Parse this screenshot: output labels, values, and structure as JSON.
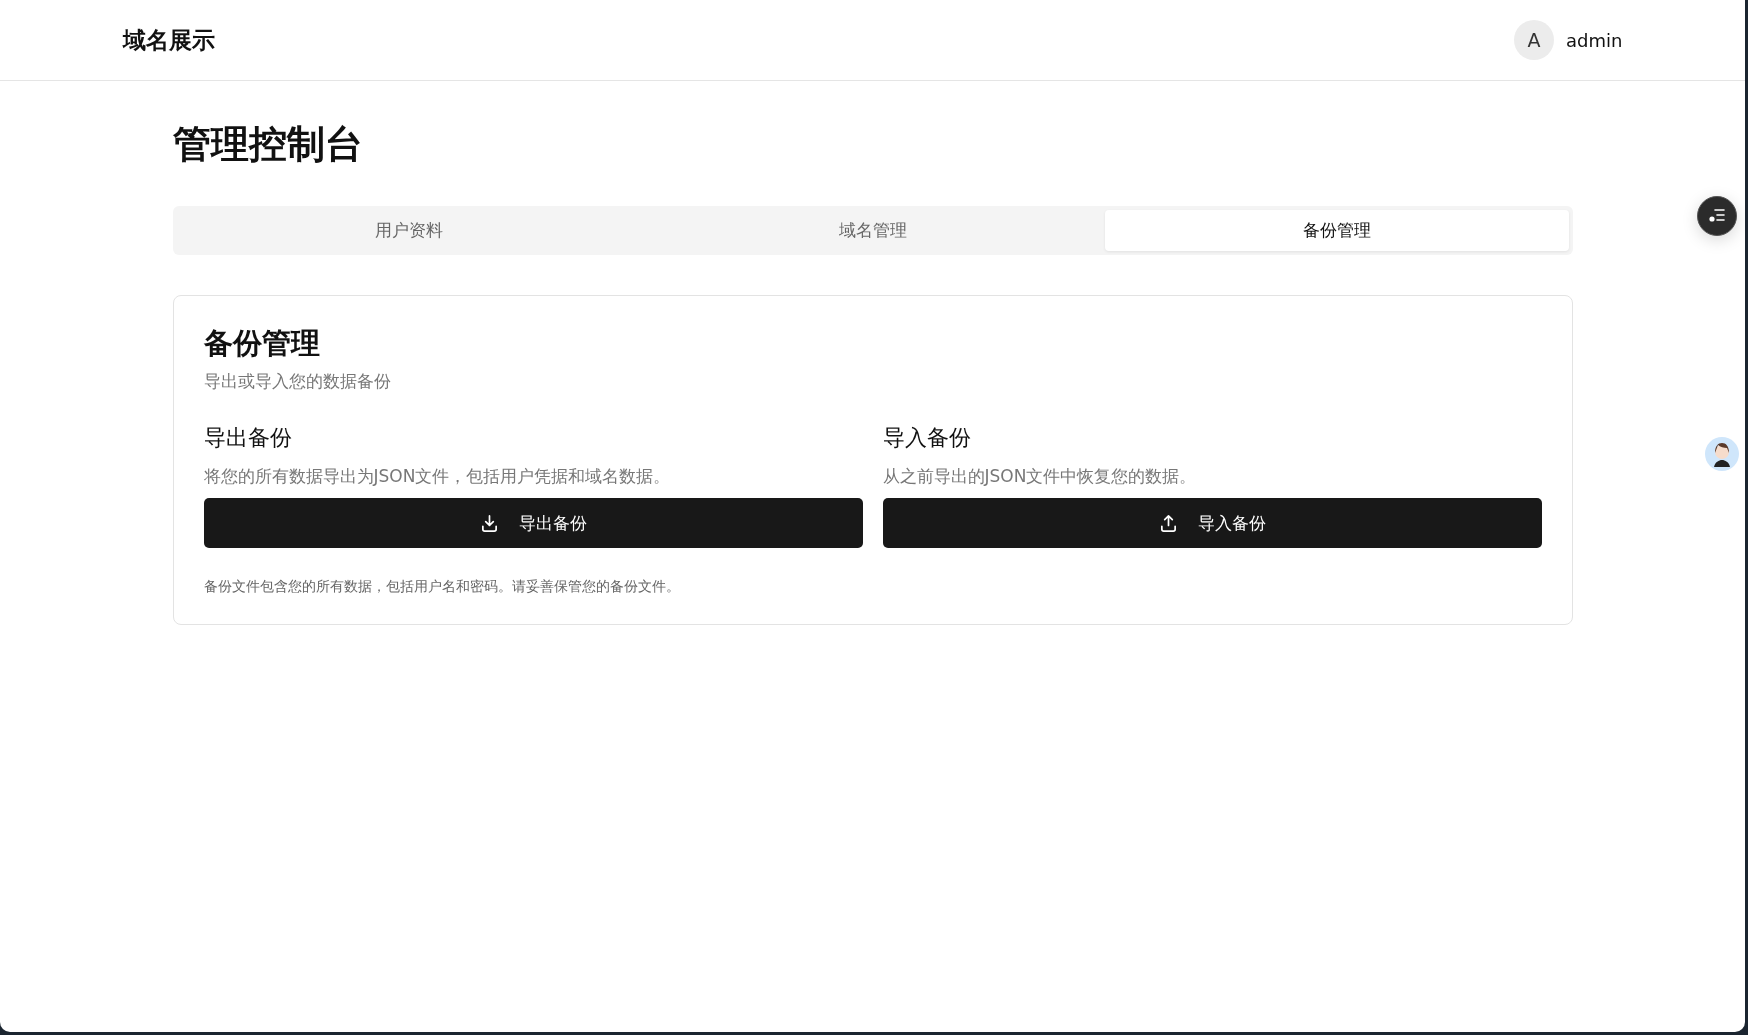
{
  "header": {
    "logo": "域名展示",
    "user": {
      "initial": "A",
      "name": "admin"
    }
  },
  "page_title": "管理控制台",
  "tabs": [
    {
      "label": "用户资料",
      "selected": false
    },
    {
      "label": "域名管理",
      "selected": false
    },
    {
      "label": "备份管理",
      "selected": true
    }
  ],
  "card": {
    "title": "备份管理",
    "subtitle": "导出或导入您的数据备份",
    "sections": [
      {
        "kind": "export",
        "title": "导出备份",
        "description": "将您的所有数据导出为JSON文件，包括用户凭据和域名数据。",
        "button": "导出备份"
      },
      {
        "kind": "import",
        "title": "导入备份",
        "description": "从之前导出的JSON文件中恢复您的数据。",
        "button": "导入备份"
      }
    ],
    "note": "备份文件包含您的所有数据，包括用户名和密码。请妥善保管您的备份文件。"
  }
}
